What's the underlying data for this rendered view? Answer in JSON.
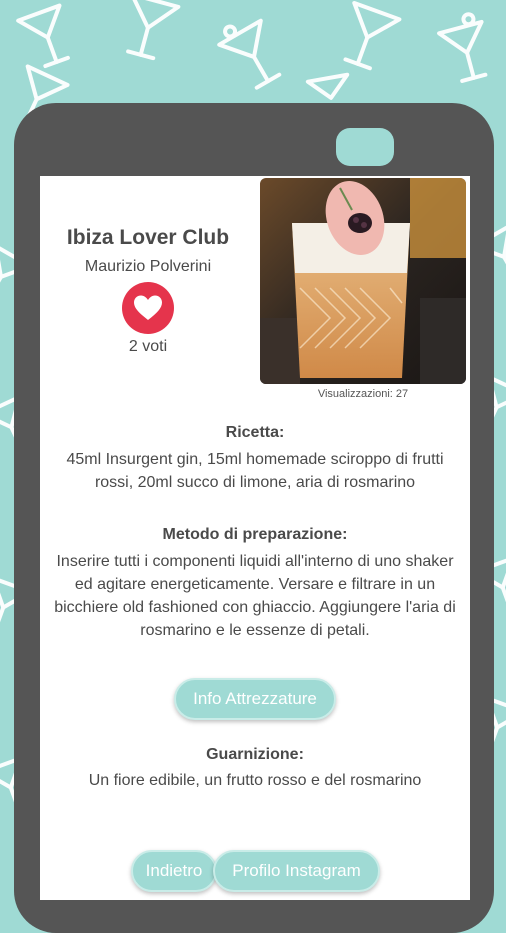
{
  "recipe": {
    "title": "Ibiza Lover Club",
    "author": "Maurizio Polverini",
    "votes": "2 voti",
    "views": "Visualizzazioni: 27",
    "ingredients_heading": "Ricetta:",
    "ingredients": "45ml Insurgent gin, 15ml homemade sciroppo di frutti rossi, 20ml succo di limone, aria di rosmarino",
    "method_heading": "Metodo di preparazione:",
    "method": "Inserire tutti i componenti liquidi all'interno di uno shaker ed agitare energeticamente. Versare e filtrare in un bicchiere old fashioned con ghiaccio. Aggiungere l'aria di rosmarino e le essenze di petali.",
    "garnish_heading": "Guarnizione:",
    "garnish": "Un fiore edibile, un frutto rosso e del rosmarino"
  },
  "buttons": {
    "equipment": "Info Attrezzature",
    "back": "Indietro",
    "instagram": "Profilo Instagram"
  },
  "icons": {
    "like": "heart-icon",
    "background": "cocktail-glass-icon"
  },
  "colors": {
    "accent": "#9fdad4",
    "like": "#e5344c",
    "frame": "#555555"
  }
}
